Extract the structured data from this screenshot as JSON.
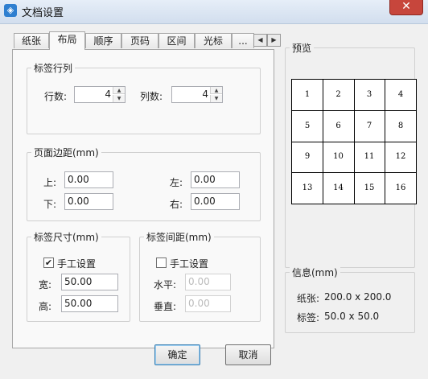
{
  "window": {
    "title": "文档设置",
    "close": "✕"
  },
  "tabs": [
    "纸张",
    "布局",
    "顺序",
    "页码",
    "区间",
    "光标",
    "..."
  ],
  "tab_scroll": {
    "left": "◀",
    "right": "▶"
  },
  "label_rows_cols": {
    "title": "标签行列",
    "rows_label": "行数:",
    "rows_value": "4",
    "cols_label": "列数:",
    "cols_value": "4"
  },
  "page_margin": {
    "title": "页面边距(mm)",
    "top_label": "上:",
    "top_value": "0.00",
    "left_label": "左:",
    "left_value": "0.00",
    "bottom_label": "下:",
    "bottom_value": "0.00",
    "right_label": "右:",
    "right_value": "0.00"
  },
  "label_size": {
    "title": "标签尺寸(mm)",
    "manual_label": "手工设置",
    "manual_checked": "✔",
    "width_label": "宽:",
    "width_value": "50.00",
    "height_label": "高:",
    "height_value": "50.00"
  },
  "label_spacing": {
    "title": "标签间距(mm)",
    "manual_label": "手工设置",
    "h_label": "水平:",
    "h_value": "0.00",
    "v_label": "垂直:",
    "v_value": "0.00"
  },
  "preview": {
    "title": "预览",
    "cells": [
      "1",
      "2",
      "3",
      "4",
      "5",
      "6",
      "7",
      "8",
      "9",
      "10",
      "11",
      "12",
      "13",
      "14",
      "15",
      "16"
    ]
  },
  "info": {
    "title": "信息(mm)",
    "paper_label": "纸张:",
    "paper_value": "200.0 x 200.0",
    "label_label": "标签:",
    "label_value": "50.0 x 50.0"
  },
  "buttons": {
    "ok": "确定",
    "cancel": "取消"
  }
}
